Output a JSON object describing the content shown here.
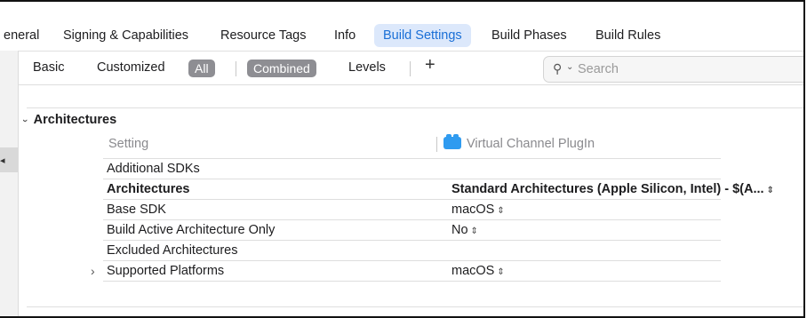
{
  "tabs": [
    {
      "label": "eneral"
    },
    {
      "label": "Signing & Capabilities"
    },
    {
      "label": "Resource Tags"
    },
    {
      "label": "Info"
    },
    {
      "label": "Build Settings"
    },
    {
      "label": "Build Phases"
    },
    {
      "label": "Build Rules"
    }
  ],
  "filters": {
    "basic": "Basic",
    "customized": "Customized",
    "all": "All",
    "combined": "Combined",
    "levels": "Levels",
    "add": "+"
  },
  "search": {
    "placeholder": "Search"
  },
  "section": {
    "title": "Architectures"
  },
  "columns": {
    "setting": "Setting",
    "target": "Virtual Channel PlugIn"
  },
  "settings": [
    {
      "name": "Additional SDKs",
      "value": ""
    },
    {
      "name": "Architectures",
      "value": "Standard Architectures (Apple Silicon, Intel)  -  $(A..."
    },
    {
      "name": "Base SDK",
      "value": "macOS"
    },
    {
      "name": "Build Active Architecture Only",
      "value": "No"
    },
    {
      "name": "Excluded Architectures",
      "value": ""
    },
    {
      "name": "Supported Platforms",
      "value": "macOS"
    }
  ],
  "icons": {
    "disclosure_open": "chevron-down-icon",
    "disclosure_closed": "chevron-right-icon",
    "search": "magnifier-icon",
    "target": "target-icon",
    "stepper": "up-down-stepper-icon"
  },
  "colors": {
    "accent": "#1a6fd6",
    "selected_tab_bg": "#dce8fb",
    "target_icon": "#2f9bf0",
    "pill": "#8e8e93"
  }
}
